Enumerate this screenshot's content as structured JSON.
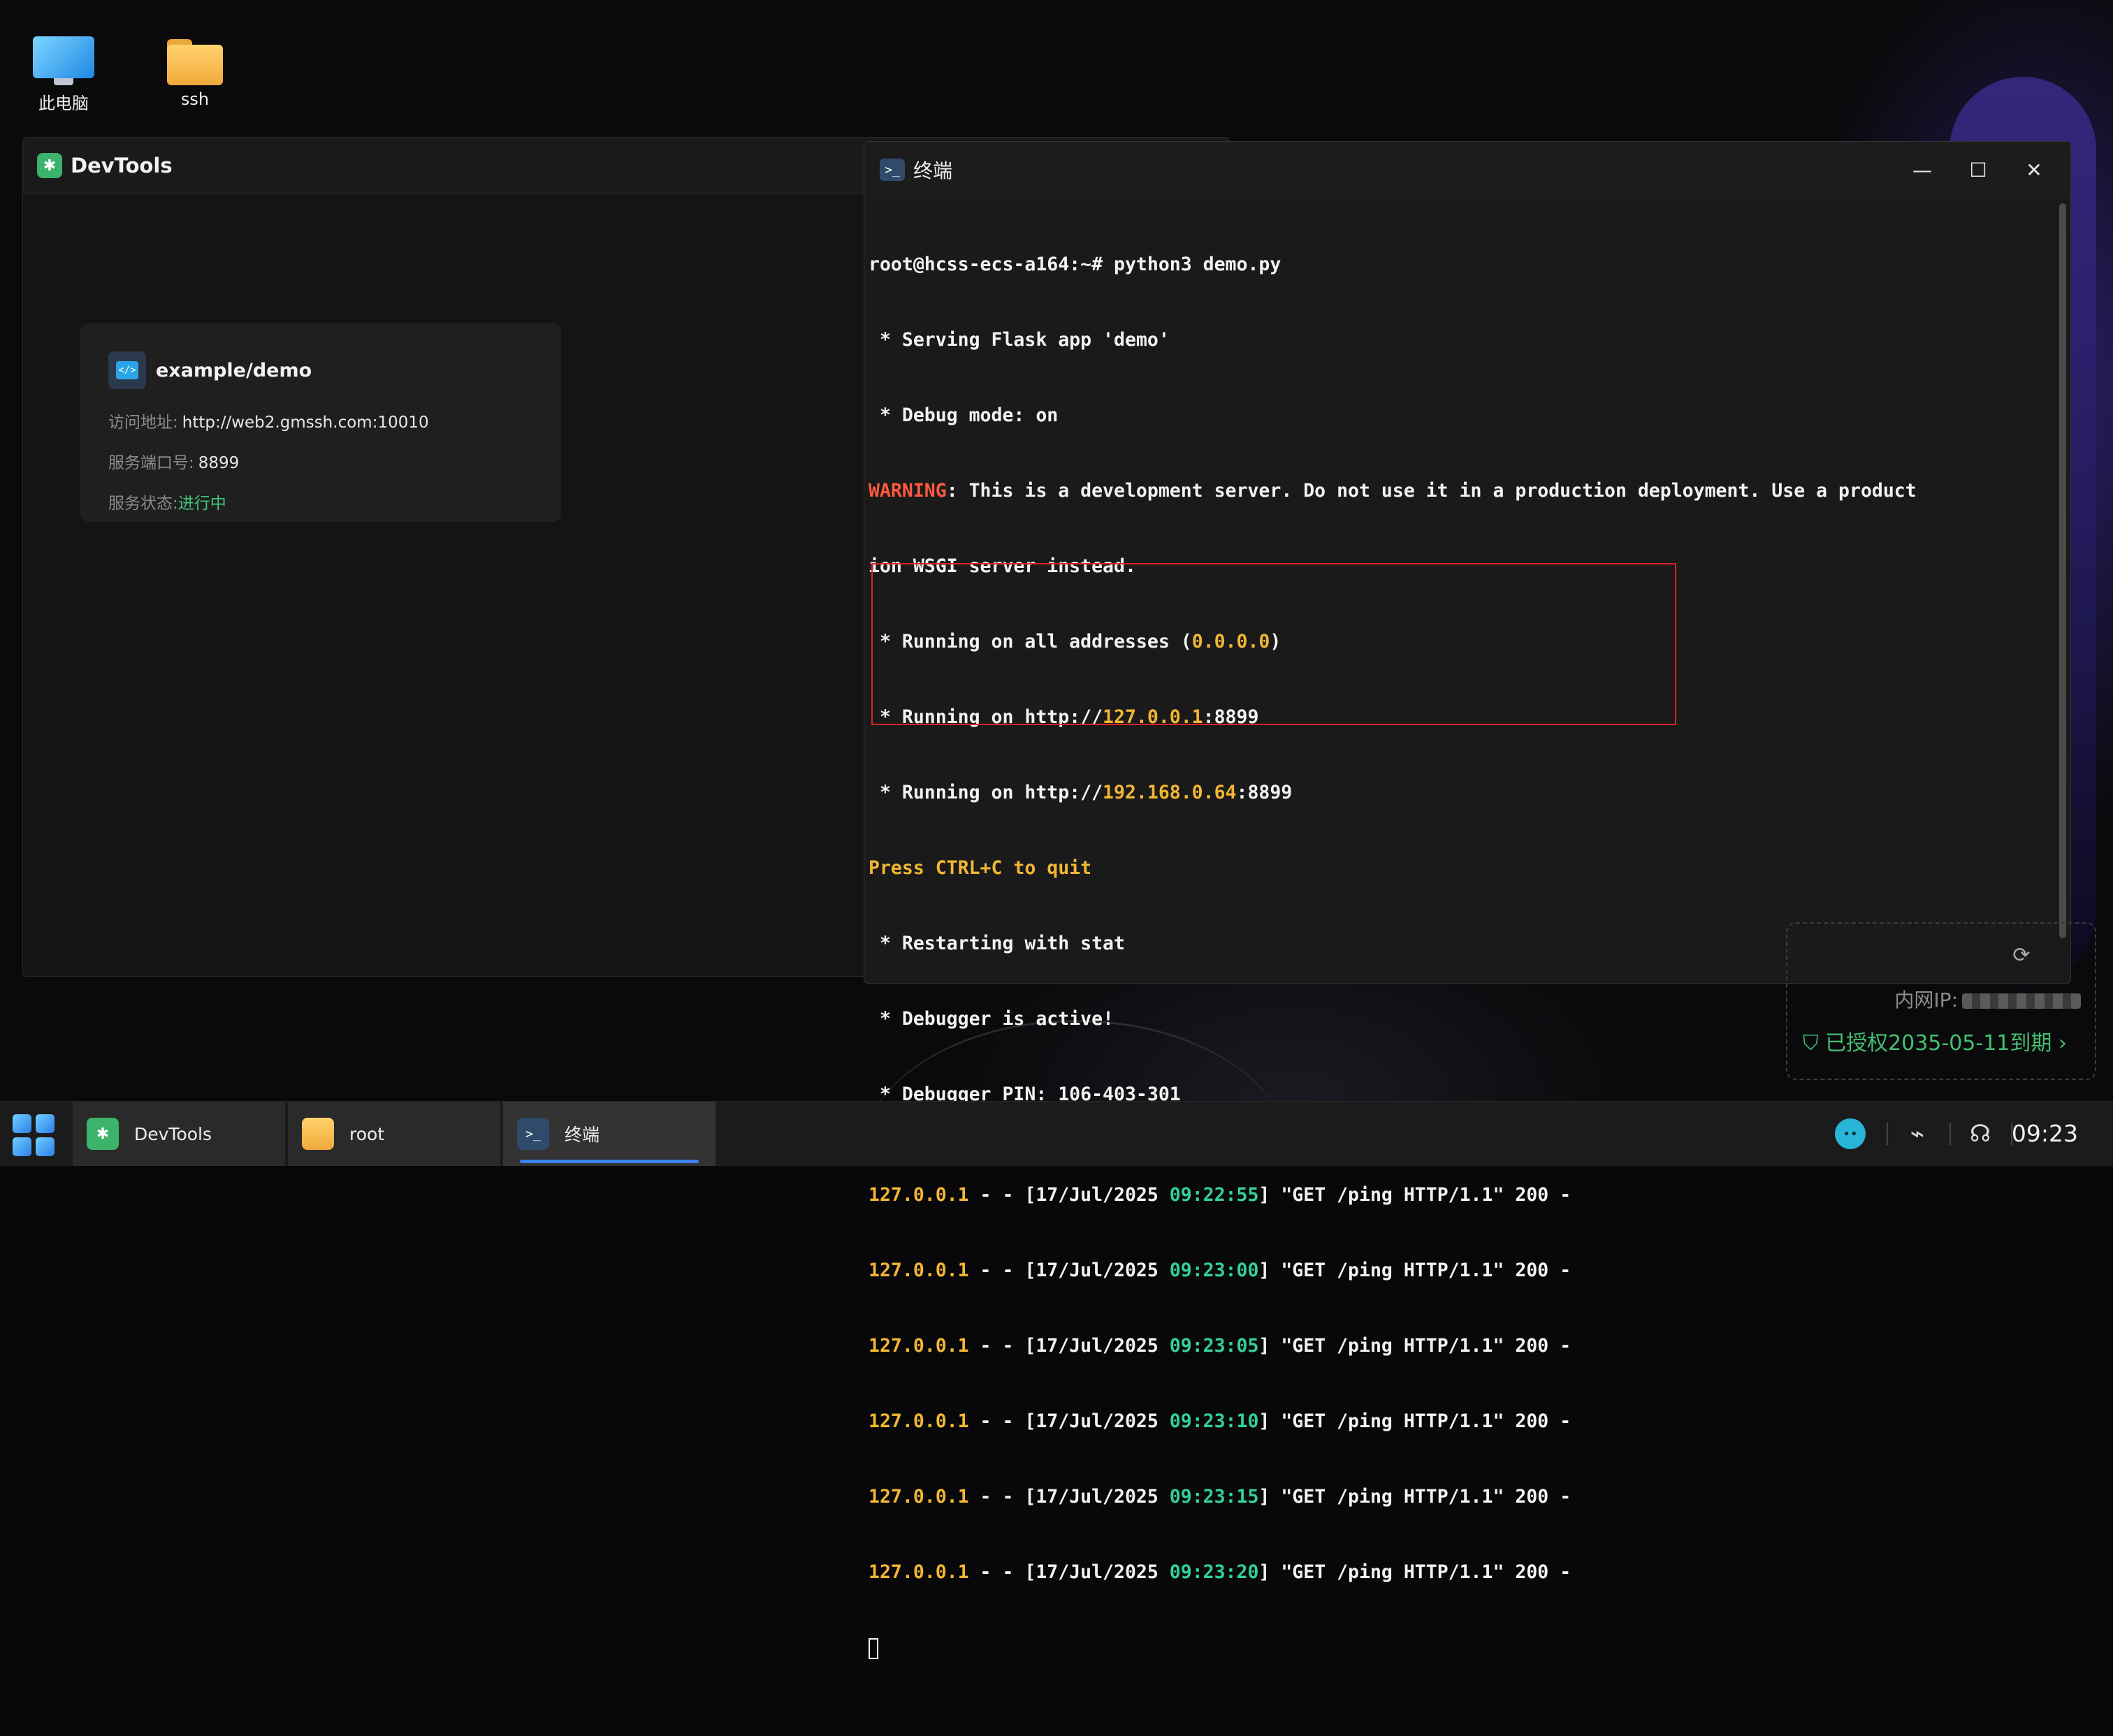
{
  "desktop": {
    "icons": [
      {
        "label": "此电脑"
      },
      {
        "label": "ssh"
      }
    ]
  },
  "devtools": {
    "title": "DevTools",
    "card": {
      "name": "example/demo",
      "url_label": "访问地址:",
      "url_value": "http://web2.gmssh.com:10010",
      "port_label": "服务端口号:",
      "port_value": "8899",
      "status_label": "服务状态:",
      "status_value": "进行中"
    }
  },
  "terminal": {
    "title": "终端",
    "lines": {
      "l1": "root@hcss-ecs-a164:~# python3 demo.py",
      "l2": " * Serving Flask app 'demo'",
      "l3": " * Debug mode: on",
      "l4_warn": "WARNING",
      "l4_rest": ": This is a development server. Do not use it in a production deployment. Use a product",
      "l5": "ion WSGI server instead.",
      "l6_a": " * Running on all addresses (",
      "l6_b": "0.0.0.0",
      "l6_c": ")",
      "l7_a": " * Running on http://",
      "l7_b": "127.0.0.1",
      "l7_c": ":8899",
      "l8_a": " * Running on http://",
      "l8_b": "192.168.0.64",
      "l8_c": ":8899",
      "l9": "Press CTRL+C to quit",
      "l10": " * Restarting with stat",
      "l11": " * Debugger is active!",
      "l12": " * Debugger PIN: 106-403-301"
    },
    "logs": [
      {
        "ip": "127.0.0.1",
        "pre": " - - [17/Jul/2025 ",
        "time": "09:22:55",
        "post": "] \"GET /ping HTTP/1.1\" 200 -"
      },
      {
        "ip": "127.0.0.1",
        "pre": " - - [17/Jul/2025 ",
        "time": "09:23:00",
        "post": "] \"GET /ping HTTP/1.1\" 200 -"
      },
      {
        "ip": "127.0.0.1",
        "pre": " - - [17/Jul/2025 ",
        "time": "09:23:05",
        "post": "] \"GET /ping HTTP/1.1\" 200 -"
      },
      {
        "ip": "127.0.0.1",
        "pre": " - - [17/Jul/2025 ",
        "time": "09:23:10",
        "post": "] \"GET /ping HTTP/1.1\" 200 -"
      },
      {
        "ip": "127.0.0.1",
        "pre": " - - [17/Jul/2025 ",
        "time": "09:23:15",
        "post": "] \"GET /ping HTTP/1.1\" 200 -"
      },
      {
        "ip": "127.0.0.1",
        "pre": " - - [17/Jul/2025 ",
        "time": "09:23:20",
        "post": "] \"GET /ping HTTP/1.1\" 200 -"
      }
    ]
  },
  "widget": {
    "ip_label": "内网IP:",
    "license": "已授权2035-05-11到期"
  },
  "taskbar": {
    "tasks": [
      {
        "label": "DevTools"
      },
      {
        "label": "root"
      },
      {
        "label": "终端"
      }
    ],
    "clock": "09:23"
  },
  "colors": {
    "accent": "#3b82f6",
    "warning": "#ff5a3c",
    "ip_yellow": "#f2b632",
    "time_green": "#32d19b",
    "highlight_border": "#d8242c",
    "status_green": "#46c47a"
  }
}
